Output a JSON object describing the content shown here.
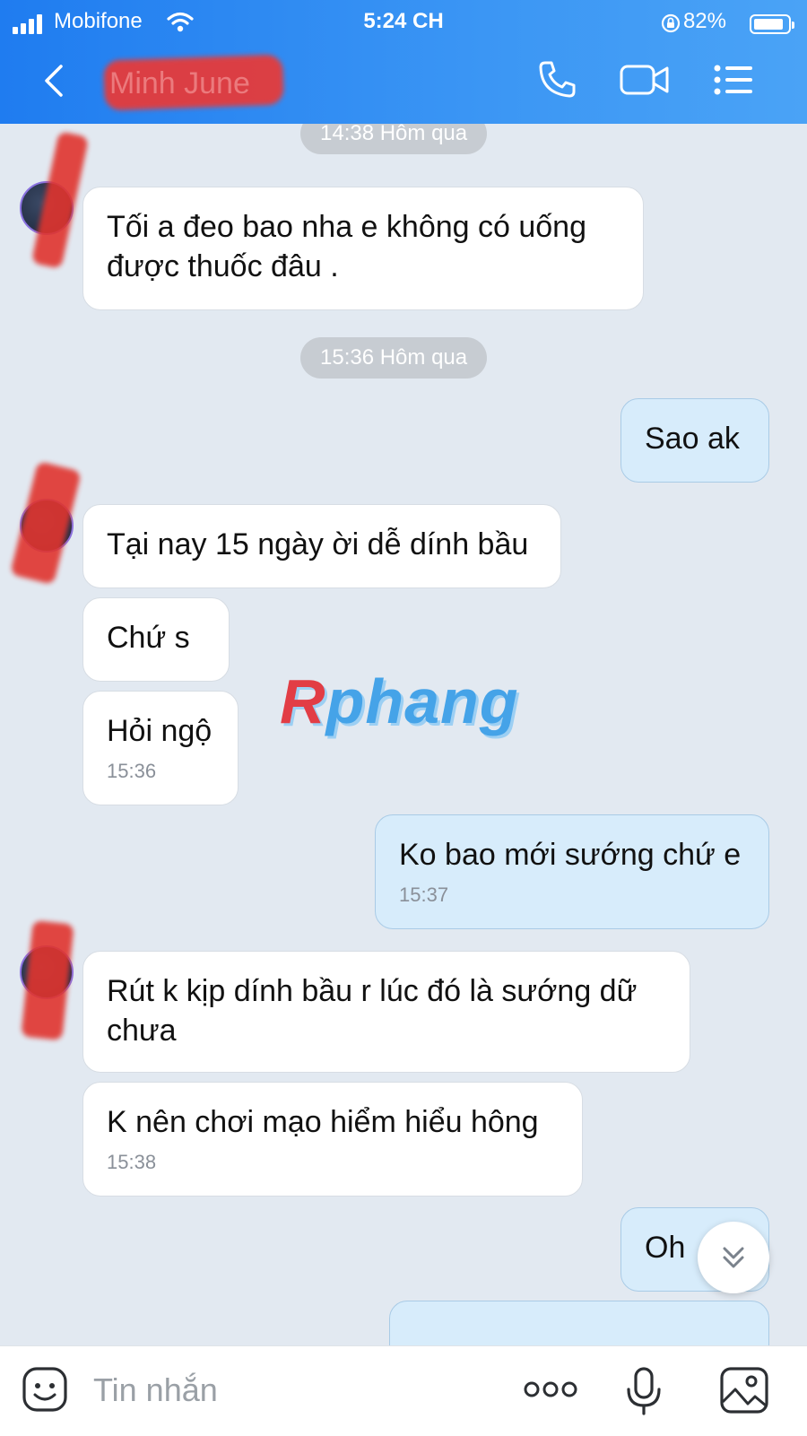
{
  "status_bar": {
    "carrier": "Mobifone",
    "time": "5:24 CH",
    "battery": "82%"
  },
  "header": {
    "contact_name": "Minh June"
  },
  "watermark": {
    "first": "R",
    "rest": "phang"
  },
  "messages": [
    {
      "type": "time",
      "text": "14:38 Hôm qua"
    },
    {
      "type": "in",
      "text": "Tối a đeo bao nha e không có uống được thuốc đâu ."
    },
    {
      "type": "time",
      "text": "15:36 Hôm qua"
    },
    {
      "type": "out",
      "text": "Sao ak"
    },
    {
      "type": "in",
      "text": "Tại nay 15 ngày ời dễ dính bầu"
    },
    {
      "type": "in",
      "text": "Chứ s"
    },
    {
      "type": "in",
      "text": "Hỏi ngộ",
      "time": "15:36"
    },
    {
      "type": "out",
      "text": "Ko bao mới sướng chứ e",
      "time": "15:37"
    },
    {
      "type": "in",
      "text": "Rút k kịp dính bầu r lúc đó là sướng dữ chưa"
    },
    {
      "type": "in",
      "text": "K nên chơi mạo hiểm hiểu hông",
      "time": "15:38"
    },
    {
      "type": "out",
      "text": "Oh"
    }
  ],
  "composer": {
    "placeholder": "Tin nhắn"
  },
  "icons": [
    "signal-icon",
    "wifi-icon",
    "lock-rotation-icon",
    "battery-icon",
    "back-icon",
    "phone-icon",
    "video-call-icon",
    "menu-icon",
    "chevron-double-down-icon",
    "sticker-icon",
    "more-icon",
    "microphone-icon",
    "image-icon"
  ]
}
